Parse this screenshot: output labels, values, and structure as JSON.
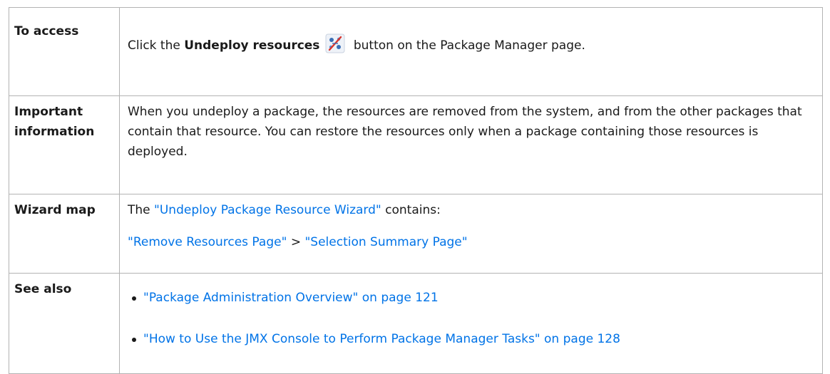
{
  "rows": {
    "access": {
      "label": "To access",
      "prefix": "Click the ",
      "button_name": "Undeploy resources",
      "suffix": " button on the Package Manager page.",
      "icon": "undeploy-resources-icon"
    },
    "important": {
      "label": "Important information",
      "text": "When you undeploy a package, the resources are removed from the system, and from the other packages that contain that resource. You can restore the resources only when a package containing those resources is deployed."
    },
    "wizard": {
      "label": "Wizard map",
      "intro_prefix": "The ",
      "wizard_link": "\"Undeploy Package Resource Wizard\"",
      "intro_suffix": " contains:",
      "step1_link": "\"Remove Resources Page\"",
      "separator": " > ",
      "step2_link": "\"Selection Summary Page\""
    },
    "seealso": {
      "label": "See also",
      "items": [
        "\"Package Administration Overview\" on page 121",
        "\"How to Use the JMX Console to Perform Package Manager Tasks\" on page 128"
      ]
    }
  },
  "colors": {
    "link": "#0073e7",
    "border": "#b3b3b3",
    "text": "#1a1a1a"
  }
}
